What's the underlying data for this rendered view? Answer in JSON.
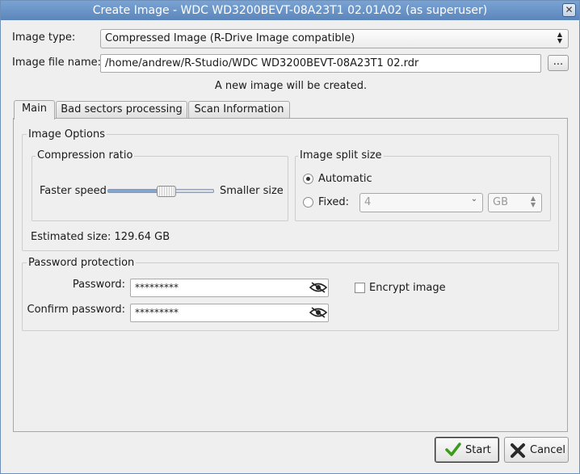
{
  "window": {
    "title": "Create Image - WDC WD3200BEVT-08A23T1 02.01A02 (as superuser)",
    "close_glyph": "✕"
  },
  "form": {
    "image_type_label": "Image type:",
    "image_type_value": "Compressed Image (R-Drive Image compatible)",
    "image_file_label": "Image file name:",
    "image_file_value": "/home/andrew/R-Studio/WDC WD3200BEVT-08A23T1 02.rdr",
    "browse_label": "...",
    "status_message": "A new image will be created."
  },
  "tabs": [
    {
      "label": "Main",
      "active": true
    },
    {
      "label": "Bad sectors processing",
      "active": false
    },
    {
      "label": "Scan Information",
      "active": false
    }
  ],
  "image_options": {
    "title": "Image Options",
    "compression": {
      "title": "Compression ratio",
      "left_label": "Faster speed",
      "right_label": "Smaller size",
      "level_fraction": 0.55
    },
    "split": {
      "title": "Image split size",
      "automatic_label": "Automatic",
      "automatic_selected": true,
      "fixed_label": "Fixed:",
      "fixed_value": "4",
      "unit_value": "GB"
    },
    "estimated_size": "Estimated size: 129.64 GB"
  },
  "password": {
    "title": "Password protection",
    "password_label": "Password:",
    "password_value": "*********",
    "confirm_label": "Confirm password:",
    "confirm_value": "*********",
    "encrypt_label": "Encrypt image",
    "encrypt_checked": false
  },
  "footer": {
    "start_label": "Start",
    "cancel_label": "Cancel"
  },
  "colors": {
    "titlebar": "#5c86bb",
    "start_icon": "#3d9a1e",
    "cancel_icon": "#2a2a2a"
  }
}
